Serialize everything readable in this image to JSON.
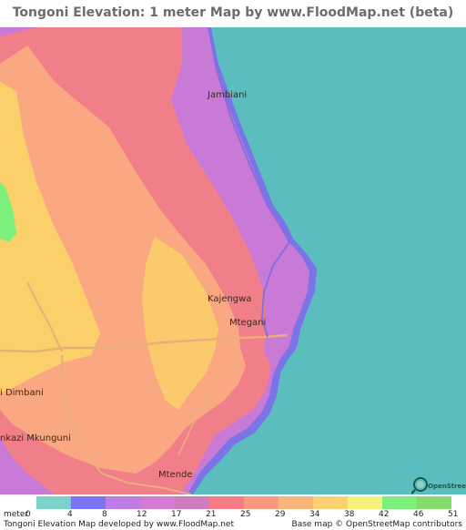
{
  "title": "Tongoni Elevation: 1 meter Map by www.FloodMap.net (beta)",
  "map": {
    "places": [
      {
        "id": "jambiani",
        "label": "Jambiani"
      },
      {
        "id": "kajengwa",
        "label": "Kajengwa"
      },
      {
        "id": "mtegani",
        "label": "Mtegani"
      },
      {
        "id": "dimbani",
        "label": "i Dimbani"
      },
      {
        "id": "mkunguni",
        "label": "nkazi Mkunguni"
      },
      {
        "id": "mtende",
        "label": "Mtende"
      }
    ],
    "colors": {
      "sea": "#5bbdbe",
      "coast_dark": "#7a74e6",
      "low": "#c87ad6",
      "mid": "#f07f89",
      "high": "#f9a882",
      "higher": "#fbd06a",
      "peak": "#7cf07c"
    },
    "osm_logo": "OpenStreetMap"
  },
  "legend": {
    "unit_label": "meter",
    "ticks": [
      "0",
      "4",
      "8",
      "12",
      "17",
      "21",
      "25",
      "29",
      "34",
      "38",
      "42",
      "46",
      "51"
    ],
    "colors": [
      "#79d1c8",
      "#7b75f4",
      "#bf7be6",
      "#d57ad0",
      "#cf7bbf",
      "#f87e86",
      "#fb997f",
      "#fbb47a",
      "#fbd273",
      "#f6f279",
      "#7df07c",
      "#85dc6a"
    ]
  },
  "footer": {
    "left": "Tongoni Elevation Map developed by www.FloodMap.net",
    "right": "Base map © OpenStreetMap contributors"
  }
}
